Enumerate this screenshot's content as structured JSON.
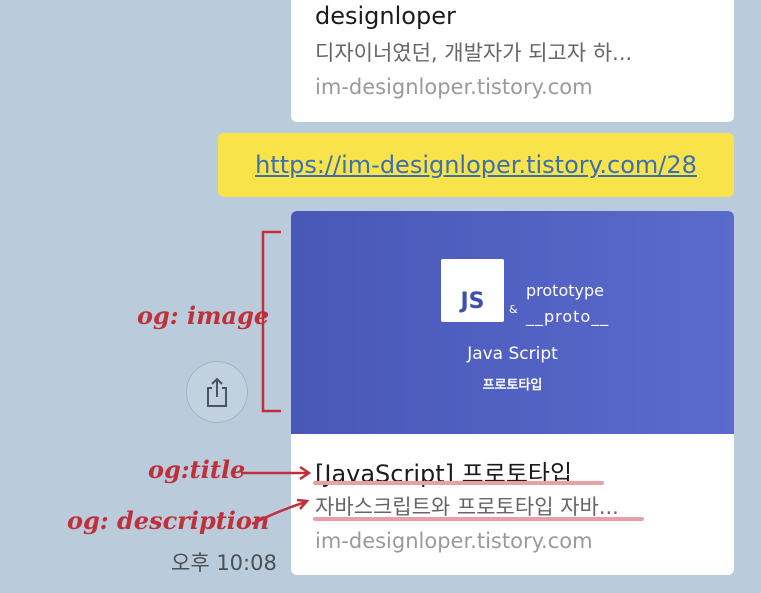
{
  "previous_card": {
    "title": "designloper",
    "description": "디자이너였던, 개발자가 되고자 하...",
    "domain": "im-designloper.tistory.com"
  },
  "link_message": {
    "url": "https://im-designloper.tistory.com/28"
  },
  "preview_card": {
    "image": {
      "js_badge": "JS",
      "amp": "&",
      "line1": "prototype",
      "line2": "__proto__",
      "caption": "Java Script",
      "subcaption": "프로토타입"
    },
    "title": "[JavaScript] 프로토타입",
    "description": "자바스크립트와 프로토타입 자바...",
    "domain": "im-designloper.tistory.com"
  },
  "timestamp": "오후 10:08",
  "annotations": {
    "image": "og: image",
    "title": "og:title",
    "description": "og: description"
  },
  "colors": {
    "background": "#bacbdb",
    "link_bubble": "#f8e34b",
    "link_text": "#3a6fb3",
    "og_image_bg": "#4f5fc2",
    "annotation": "#c0303a"
  },
  "icons": {
    "share": "share-icon"
  }
}
